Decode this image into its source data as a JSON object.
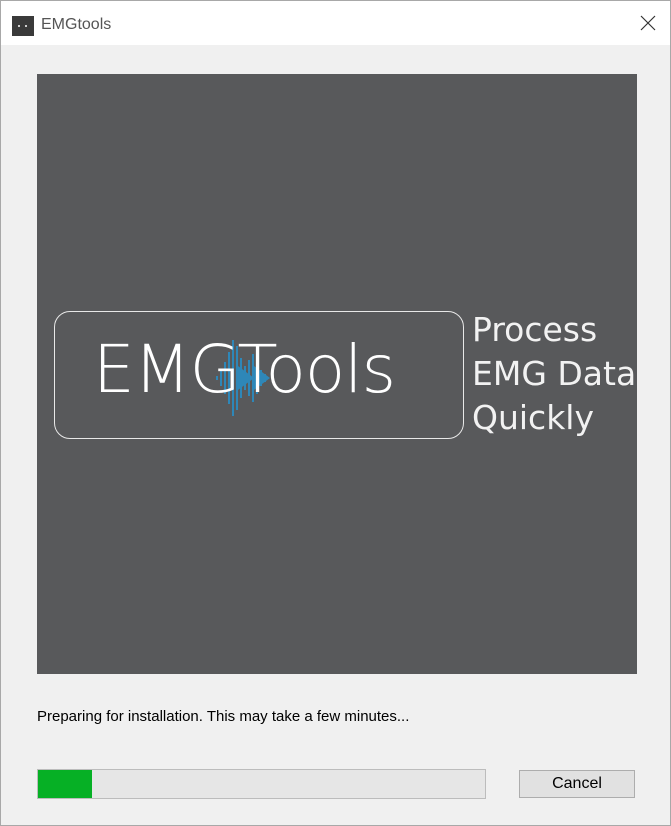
{
  "window": {
    "title": "EMGtools",
    "icon": "app-icon",
    "close_icon": "close-icon"
  },
  "banner": {
    "logo_text": "EMGTools",
    "tagline_lines": [
      "Process",
      "EMG Data",
      "Quickly"
    ],
    "background_color": "#58595b",
    "wave_color": "#2e87b8"
  },
  "status": {
    "message": "Preparing for installation. This may take a few minutes..."
  },
  "progress": {
    "fraction": 0.12,
    "fill_color": "#06b025"
  },
  "buttons": {
    "cancel_label": "Cancel"
  }
}
